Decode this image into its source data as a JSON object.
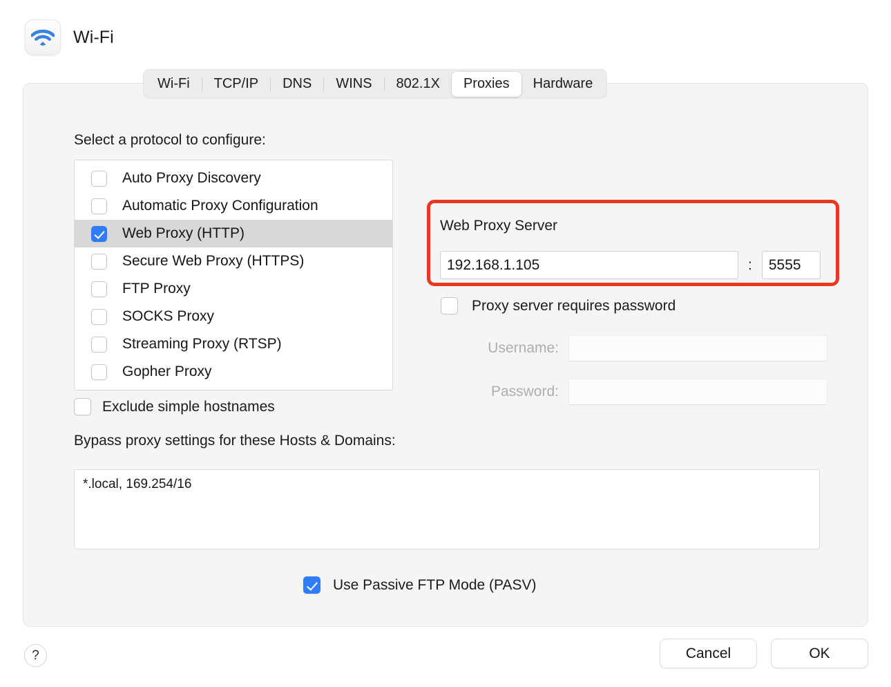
{
  "header": {
    "title": "Wi-Fi",
    "icon": "wifi-icon"
  },
  "tabs": [
    {
      "label": "Wi-Fi",
      "selected": false
    },
    {
      "label": "TCP/IP",
      "selected": false
    },
    {
      "label": "DNS",
      "selected": false
    },
    {
      "label": "WINS",
      "selected": false
    },
    {
      "label": "802.1X",
      "selected": false
    },
    {
      "label": "Proxies",
      "selected": true
    },
    {
      "label": "Hardware",
      "selected": false
    }
  ],
  "protocols": {
    "label": "Select a protocol to configure:",
    "items": [
      {
        "label": "Auto Proxy Discovery",
        "checked": false,
        "selected": false
      },
      {
        "label": "Automatic Proxy Configuration",
        "checked": false,
        "selected": false
      },
      {
        "label": "Web Proxy (HTTP)",
        "checked": true,
        "selected": true
      },
      {
        "label": "Secure Web Proxy (HTTPS)",
        "checked": false,
        "selected": false
      },
      {
        "label": "FTP Proxy",
        "checked": false,
        "selected": false
      },
      {
        "label": "SOCKS Proxy",
        "checked": false,
        "selected": false
      },
      {
        "label": "Streaming Proxy (RTSP)",
        "checked": false,
        "selected": false
      },
      {
        "label": "Gopher Proxy",
        "checked": false,
        "selected": false
      }
    ]
  },
  "web_proxy_server": {
    "title": "Web Proxy Server",
    "host_value": "192.168.1.105",
    "host_placeholder": "",
    "separator": ":",
    "port_value": "5555",
    "port_placeholder": "",
    "highlight_color": "#e8391e"
  },
  "auth": {
    "requires_password_label": "Proxy server requires password",
    "requires_password_checked": false,
    "username_label": "Username:",
    "username_value": "",
    "password_label": "Password:",
    "password_value": "",
    "disabled": true
  },
  "exclude": {
    "label": "Exclude simple hostnames",
    "checked": false
  },
  "bypass": {
    "label": "Bypass proxy settings for these Hosts & Domains:",
    "value": "*.local, 169.254/16"
  },
  "passive_ftp": {
    "label": "Use Passive FTP Mode (PASV)",
    "checked": true
  },
  "footer": {
    "help_label": "?",
    "cancel_label": "Cancel",
    "ok_label": "OK"
  },
  "colors": {
    "accent_blue": "#2f7cf6",
    "annotation_red": "#e8391e",
    "panel_bg": "#f5f5f5",
    "selected_row": "#d8d8d8"
  }
}
